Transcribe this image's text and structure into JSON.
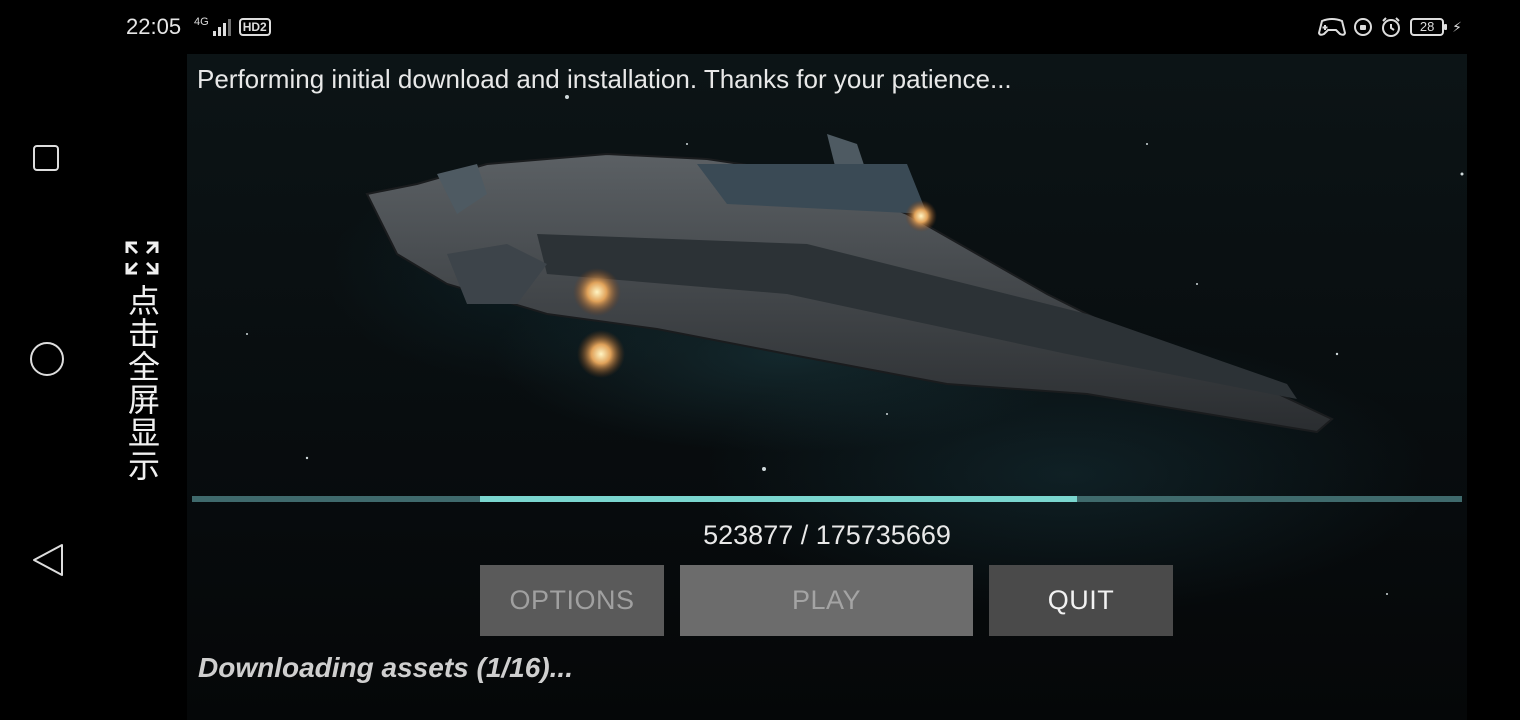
{
  "status_bar": {
    "time": "22:05",
    "network": "4G",
    "hd_badge": "HD2",
    "battery": "28"
  },
  "fullscreen_hint": {
    "label": "点击全屏显示"
  },
  "game": {
    "title": "Performing initial download and installation.  Thanks for your patience...",
    "progress": {
      "text": "523877 / 175735669",
      "bar_start": 0.227,
      "bar_end": 0.697
    },
    "buttons": {
      "options": "OPTIONS",
      "play": "PLAY",
      "quit": "QUIT"
    },
    "status": "Downloading assets (1/16)..."
  }
}
